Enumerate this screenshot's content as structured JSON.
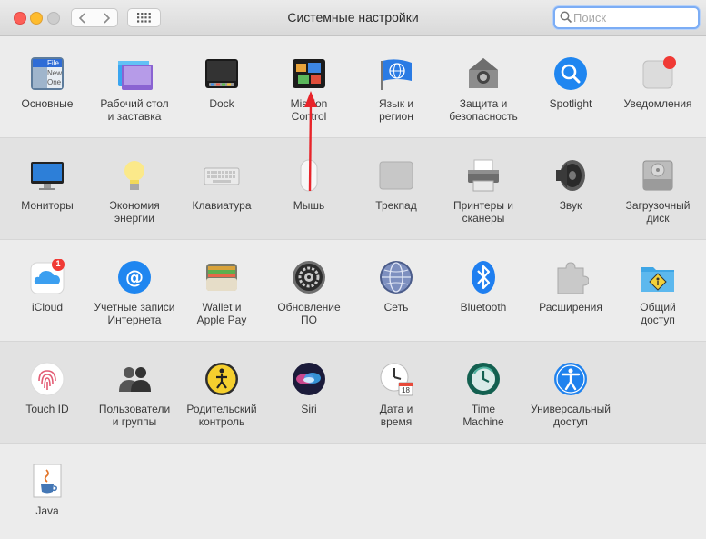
{
  "window": {
    "title": "Системные настройки"
  },
  "search": {
    "placeholder": "Поиск",
    "value": ""
  },
  "rows": [
    [
      {
        "label": "Основные",
        "icon": "general-icon"
      },
      {
        "label": "Рабочий стол\nи заставка",
        "icon": "desktop-icon"
      },
      {
        "label": "Dock",
        "icon": "dock-icon"
      },
      {
        "label": "Mission\nControl",
        "icon": "mission-control-icon"
      },
      {
        "label": "Язык и\nрегион",
        "icon": "language-icon"
      },
      {
        "label": "Защита и\nбезопасность",
        "icon": "security-icon"
      },
      {
        "label": "Spotlight",
        "icon": "spotlight-icon"
      },
      {
        "label": "Уведомления",
        "icon": "notifications-icon"
      }
    ],
    [
      {
        "label": "Мониторы",
        "icon": "displays-icon"
      },
      {
        "label": "Экономия\nэнергии",
        "icon": "energy-icon"
      },
      {
        "label": "Клавиатура",
        "icon": "keyboard-icon"
      },
      {
        "label": "Мышь",
        "icon": "mouse-icon"
      },
      {
        "label": "Трекпад",
        "icon": "trackpad-icon"
      },
      {
        "label": "Принтеры и\nсканеры",
        "icon": "printer-icon"
      },
      {
        "label": "Звук",
        "icon": "sound-icon"
      },
      {
        "label": "Загрузочный\nдиск",
        "icon": "startup-disk-icon"
      }
    ],
    [
      {
        "label": "iCloud",
        "icon": "icloud-icon",
        "badge": "1"
      },
      {
        "label": "Учетные записи\nИнтернета",
        "icon": "internet-accounts-icon"
      },
      {
        "label": "Wallet и\nApple Pay",
        "icon": "wallet-icon"
      },
      {
        "label": "Обновление\nПО",
        "icon": "software-update-icon"
      },
      {
        "label": "Сеть",
        "icon": "network-icon"
      },
      {
        "label": "Bluetooth",
        "icon": "bluetooth-icon"
      },
      {
        "label": "Расширения",
        "icon": "extensions-icon"
      },
      {
        "label": "Общий\nдоступ",
        "icon": "sharing-icon"
      }
    ],
    [
      {
        "label": "Touch ID",
        "icon": "touch-id-icon"
      },
      {
        "label": "Пользователи\nи группы",
        "icon": "users-icon"
      },
      {
        "label": "Родительский\nконтроль",
        "icon": "parental-icon"
      },
      {
        "label": "Siri",
        "icon": "siri-icon"
      },
      {
        "label": "Дата и\nвремя",
        "icon": "date-time-icon"
      },
      {
        "label": "Time\nMachine",
        "icon": "time-machine-icon"
      },
      {
        "label": "Универсальный\nдоступ",
        "icon": "accessibility-icon"
      }
    ],
    [
      {
        "label": "Java",
        "icon": "java-icon"
      }
    ]
  ],
  "icon_texts": {
    "general_file": "File",
    "general_new": "New",
    "general_one": "One",
    "icloud_badge": "1",
    "calendar_day": "18"
  },
  "colors": {
    "arrow": "#e8242a",
    "accent": "#1a82fb",
    "selection": "#7cadf5"
  }
}
